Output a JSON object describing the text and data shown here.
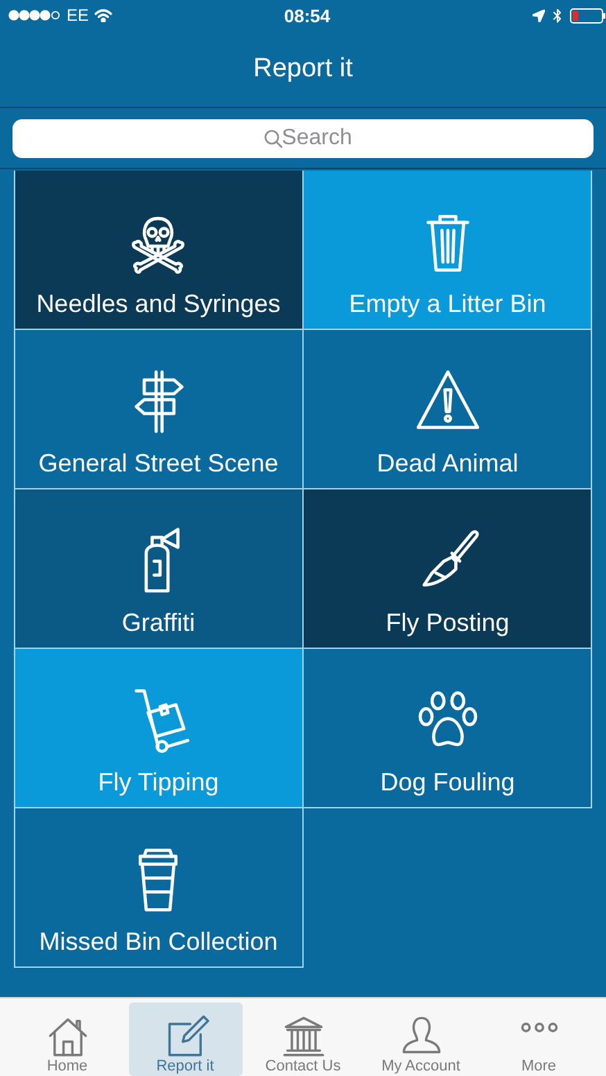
{
  "status_bar": {
    "carrier": "EE",
    "time": "08:54"
  },
  "nav_bar": {
    "title": "Report it"
  },
  "search": {
    "placeholder": "Search"
  },
  "tiles": [
    {
      "label": "Needles and Syringes",
      "kind": "skull",
      "color": "#0b3a56"
    },
    {
      "label": "Empty a Litter Bin",
      "kind": "bin",
      "color": "#0b9ad9"
    },
    {
      "label": "General Street Scene",
      "kind": "signpost",
      "color": "#0a6a9e"
    },
    {
      "label": "Dead Animal",
      "kind": "warning",
      "color": "#0a6a9e"
    },
    {
      "label": "Graffiti",
      "kind": "spray",
      "color": "#0b5a86"
    },
    {
      "label": "Fly Posting",
      "kind": "brush",
      "color": "#0b3a56"
    },
    {
      "label": "Fly Tipping",
      "kind": "trolley",
      "color": "#0b9ad9"
    },
    {
      "label": "Dog Fouling",
      "kind": "paw",
      "color": "#0a6a9e"
    },
    {
      "label": "Missed Bin Collection",
      "kind": "cup",
      "color": "#0a6a9e"
    }
  ],
  "tab_bar": [
    {
      "label": "Home",
      "kind": "home",
      "selected": false
    },
    {
      "label": "Report it",
      "kind": "report",
      "selected": true
    },
    {
      "label": "Contact Us",
      "kind": "bank",
      "selected": false
    },
    {
      "label": "My Account",
      "kind": "person",
      "selected": false
    },
    {
      "label": "More",
      "kind": "more",
      "selected": false
    }
  ]
}
